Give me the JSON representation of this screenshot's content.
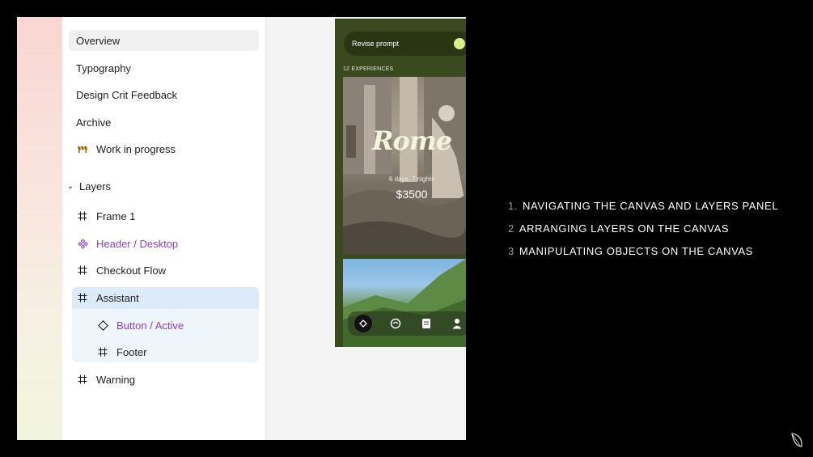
{
  "pages": [
    {
      "label": "Overview",
      "active": true
    },
    {
      "label": "Typography"
    },
    {
      "label": "Design Crit Feedback"
    },
    {
      "label": "Archive"
    },
    {
      "label": "Work in progress",
      "icon": "construction-icon"
    }
  ],
  "layers": {
    "header": "Layers",
    "items": [
      {
        "label": "Frame 1",
        "icon": "frame-icon"
      },
      {
        "label": "Header / Desktop",
        "icon": "component-icon",
        "color": "#8a3fd1"
      },
      {
        "label": "Checkout Flow",
        "icon": "frame-icon"
      },
      {
        "label": "Assistant",
        "icon": "frame-icon",
        "selected": true
      },
      {
        "label": "Button / Active",
        "icon": "instance-icon",
        "color": "#8a3fd1"
      },
      {
        "label": "Footer",
        "icon": "frame-icon"
      },
      {
        "label": "Warning",
        "icon": "frame-icon"
      }
    ]
  },
  "canvas": {
    "revise_prompt": "Revise prompt",
    "experiences_label": "12 EXPERIENCES",
    "card": {
      "title": "Rome",
      "duration": "6 days, 7 nights",
      "price": "$3500"
    },
    "nav_icons": [
      "explore-icon",
      "globe-icon",
      "bookings-icon",
      "profile-icon"
    ]
  },
  "agenda": [
    {
      "num": "1.",
      "text": "NAVIGATING THE CANVAS AND LAYERS PANEL"
    },
    {
      "num": "2",
      "text": "ARRANGING LAYERS ON THE CANVAS"
    },
    {
      "num": "3",
      "text": "MANIPULATING OBJECTS ON THE CANVAS"
    }
  ],
  "colors": {
    "accent_purple": "#8a3fd1",
    "selection_blue": "#dcebf9",
    "phone_bg": "#3a4a1e"
  }
}
